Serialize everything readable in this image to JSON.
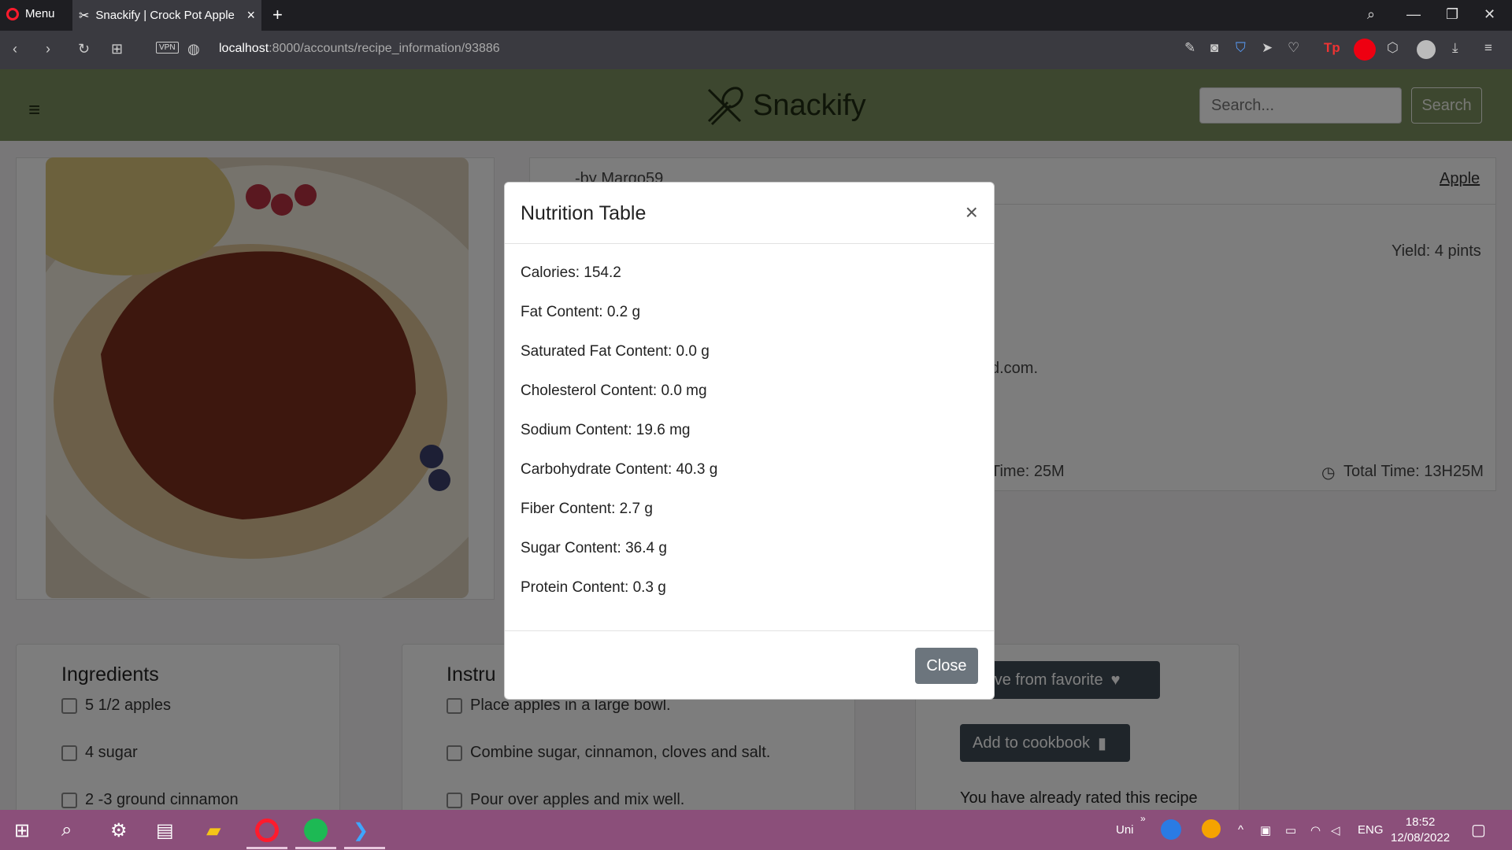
{
  "browser": {
    "menu_label": "Menu",
    "tab_title": "Snackify | Crock Pot Apple",
    "url_host": "localhost",
    "url_rest": ":8000/accounts/recipe_information/93886",
    "vpn_label": "VPN"
  },
  "site": {
    "brand": "Snackify",
    "search_placeholder": "Search...",
    "search_button": "Search",
    "author": "-by Margo59",
    "category_link": "Apple",
    "yield": "Yield: 4 pints",
    "source_fragment": "d.com.",
    "prep_time": "Time: 25M",
    "total_time": "Total Time: 13H25M",
    "ingredients_title": "Ingredients",
    "ingredients": [
      "5 1/2 apples",
      "4 sugar",
      "2 -3 ground cinnamon"
    ],
    "instructions_title": "Instru",
    "instructions": [
      "Place apples in a large bowl.",
      "Combine sugar, cinnamon, cloves and salt.",
      "Pour over apples and mix well."
    ],
    "favorite_button": "move from favorite",
    "cookbook_button": "Add to cookbook",
    "rated_text": "You have already rated this recipe"
  },
  "modal": {
    "title": "Nutrition Table",
    "close_x": "×",
    "items": [
      "Calories: 154.2",
      "Fat Content: 0.2 g",
      "Saturated Fat Content: 0.0 g",
      "Cholesterol Content: 0.0 mg",
      "Sodium Content: 19.6 mg",
      "Carbohydrate Content: 40.3 g",
      "Fiber Content: 2.7 g",
      "Sugar Content: 36.4 g",
      "Protein Content: 0.3 g"
    ],
    "close_button": "Close"
  },
  "taskbar": {
    "lang": "ENG",
    "keyboard": "Uni",
    "time": "18:52",
    "date": "12/08/2022"
  }
}
